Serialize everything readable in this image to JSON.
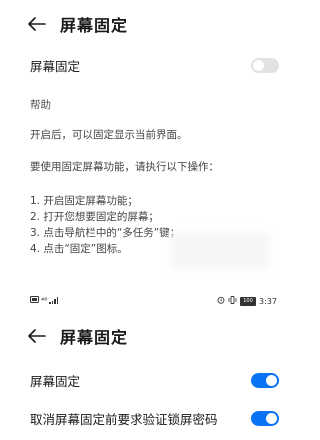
{
  "top": {
    "title": "屏幕固定",
    "setting_label": "屏幕固定",
    "toggle_on": false,
    "help_title": "帮助",
    "description": "开启后，可以固定显示当前界面。",
    "instructions_intro": "要使用固定屏幕功能，请执行以下操作：",
    "steps": [
      "1. 开启固定屏幕功能；",
      "2. 打开您想要固定的屏幕；",
      "3. 点击导航栏中的“多任务”键；",
      "4. 点击“固定”图标。"
    ]
  },
  "statusbar": {
    "signal_text": "⁴⁶",
    "battery": "100",
    "time": "3:37"
  },
  "bottom": {
    "title": "屏幕固定",
    "settings": [
      {
        "label": "屏幕固定",
        "toggle_on": true
      },
      {
        "label": "取消屏幕固定前要求验证锁屏密码",
        "toggle_on": true
      }
    ]
  },
  "colors": {
    "accent": "#0a74f5",
    "toggle_off": "#e2e2e2"
  }
}
